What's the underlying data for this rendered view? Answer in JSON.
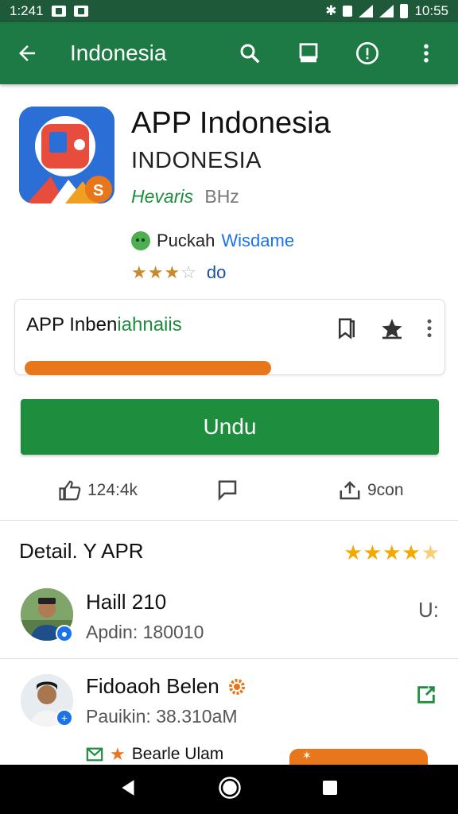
{
  "status_bar": {
    "time_left": "1:241",
    "time_right": "10:55"
  },
  "app_bar": {
    "title": "Indonesia"
  },
  "app": {
    "name": "APP Indonesia",
    "subtitle": "INDONESIA",
    "developer": "Hevaris",
    "developer_extra": "BHz",
    "publisher_prefix": "Puckah",
    "publisher_link": "Wisdame",
    "rating_stars": 3.5,
    "rating_text": "do"
  },
  "install_card": {
    "label_plain": "APP Inben",
    "label_green": "iahnaiis",
    "progress": 0.58
  },
  "install_button": {
    "label": "Undu"
  },
  "action_row": {
    "likes": "124:4k",
    "share": "9con"
  },
  "details": {
    "title": "Detail. Y APR",
    "stars": 4.5
  },
  "reviews": [
    {
      "name": "Haill 210",
      "sub": "Apdin: 180010",
      "right": "U:"
    },
    {
      "name": "Fidoaoh Belen",
      "sub": "Pauikin: 38.310aM",
      "right": ""
    }
  ],
  "bottom_partial": {
    "text": "Bearle Ulam"
  },
  "colors": {
    "status_bar": "#1e5a3a",
    "app_bar": "#1e7a45",
    "install_green": "#1e8e3e",
    "progress_orange": "#e8761b",
    "star_gold": "#f2a900"
  }
}
